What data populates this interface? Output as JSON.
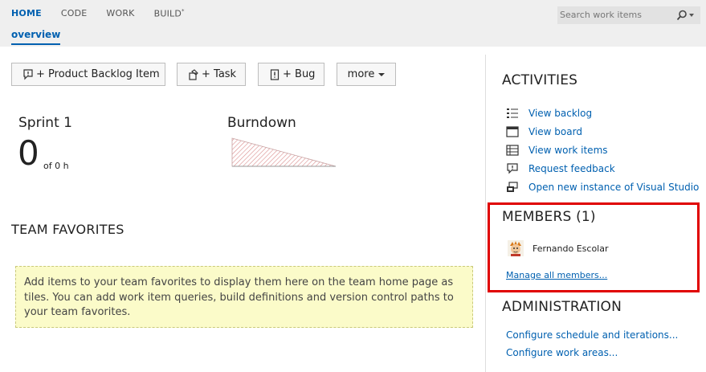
{
  "nav": {
    "items": [
      {
        "label": "HOME"
      },
      {
        "label": "CODE"
      },
      {
        "label": "WORK"
      },
      {
        "label": "BUILD"
      }
    ],
    "build_marker": "*",
    "subnav": "overview"
  },
  "search": {
    "placeholder": "Search work items"
  },
  "buttons": {
    "pbi": "+ Product Backlog Item",
    "task": "+ Task",
    "bug": "+ Bug",
    "more": "more"
  },
  "sprint": {
    "title": "Sprint 1",
    "remaining": "0",
    "of": "of 0 h"
  },
  "burndown": {
    "title": "Burndown"
  },
  "favorites": {
    "title": "TEAM FAVORITES",
    "message": "Add items to your team favorites to display them here on the team home page as tiles. You can add work item queries, build definitions and version control paths to your team favorites."
  },
  "activities": {
    "title": "ACTIVITIES",
    "items": [
      {
        "label": "View backlog",
        "icon": "backlog-list-icon"
      },
      {
        "label": "View board",
        "icon": "board-icon"
      },
      {
        "label": "View work items",
        "icon": "work-items-grid-icon"
      },
      {
        "label": "Request feedback",
        "icon": "feedback-bubble-icon"
      },
      {
        "label": "Open new instance of Visual Studio",
        "icon": "visual-studio-icon"
      }
    ]
  },
  "members": {
    "title": "MEMBERS (1)",
    "list": [
      {
        "name": "Fernando Escolar"
      }
    ],
    "manage_link": "Manage all members..."
  },
  "administration": {
    "title": "ADMINISTRATION",
    "links": [
      {
        "label": "Configure schedule and iterations..."
      },
      {
        "label": "Configure work areas..."
      }
    ]
  },
  "colors": {
    "accent": "#0060b0",
    "highlight_border": "#e00000",
    "favorites_bg": "#fbfbc9",
    "topbar_bg": "#efefef"
  }
}
